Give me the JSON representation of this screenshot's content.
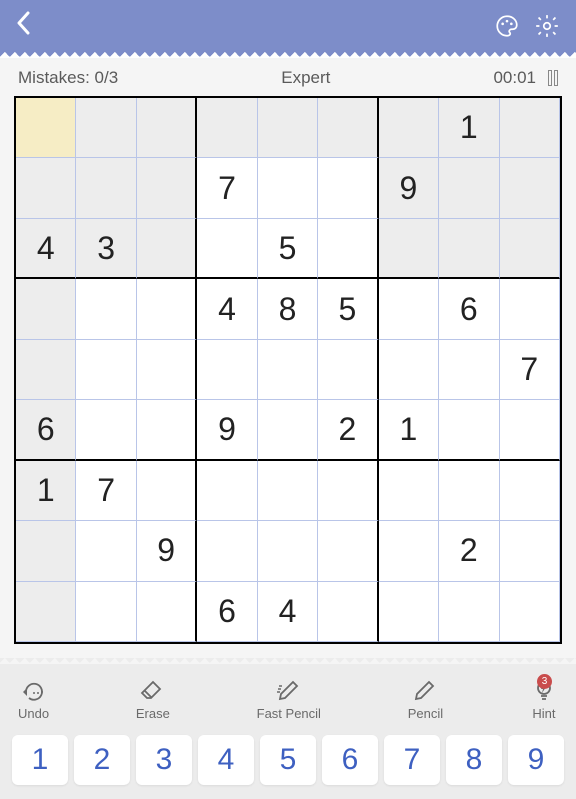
{
  "status": {
    "mistakes_label": "Mistakes: 0/3",
    "difficulty": "Expert",
    "timer": "00:01"
  },
  "toolbar": {
    "undo": "Undo",
    "erase": "Erase",
    "fast_pencil": "Fast Pencil",
    "pencil": "Pencil",
    "hint": "Hint",
    "hint_badge": "3"
  },
  "numpad": [
    "1",
    "2",
    "3",
    "4",
    "5",
    "6",
    "7",
    "8",
    "9"
  ],
  "board": {
    "selected": [
      0,
      0
    ],
    "grid": [
      [
        "",
        "",
        "",
        "",
        "",
        "",
        "",
        "1",
        ""
      ],
      [
        "",
        "",
        "",
        "7",
        "",
        "",
        "9",
        "",
        ""
      ],
      [
        "4",
        "3",
        "",
        "",
        "5",
        "",
        "",
        "",
        ""
      ],
      [
        "",
        "",
        "",
        "4",
        "8",
        "5",
        "",
        "6",
        ""
      ],
      [
        "",
        "",
        "",
        "",
        "",
        "",
        "",
        "",
        "7"
      ],
      [
        "6",
        "",
        "",
        "9",
        "",
        "2",
        "1",
        "",
        ""
      ],
      [
        "1",
        "7",
        "",
        "",
        "",
        "",
        "",
        "",
        ""
      ],
      [
        "",
        "",
        "9",
        "",
        "",
        "",
        "",
        "2",
        ""
      ],
      [
        "",
        "",
        "",
        "6",
        "4",
        "",
        "",
        "",
        ""
      ]
    ]
  }
}
